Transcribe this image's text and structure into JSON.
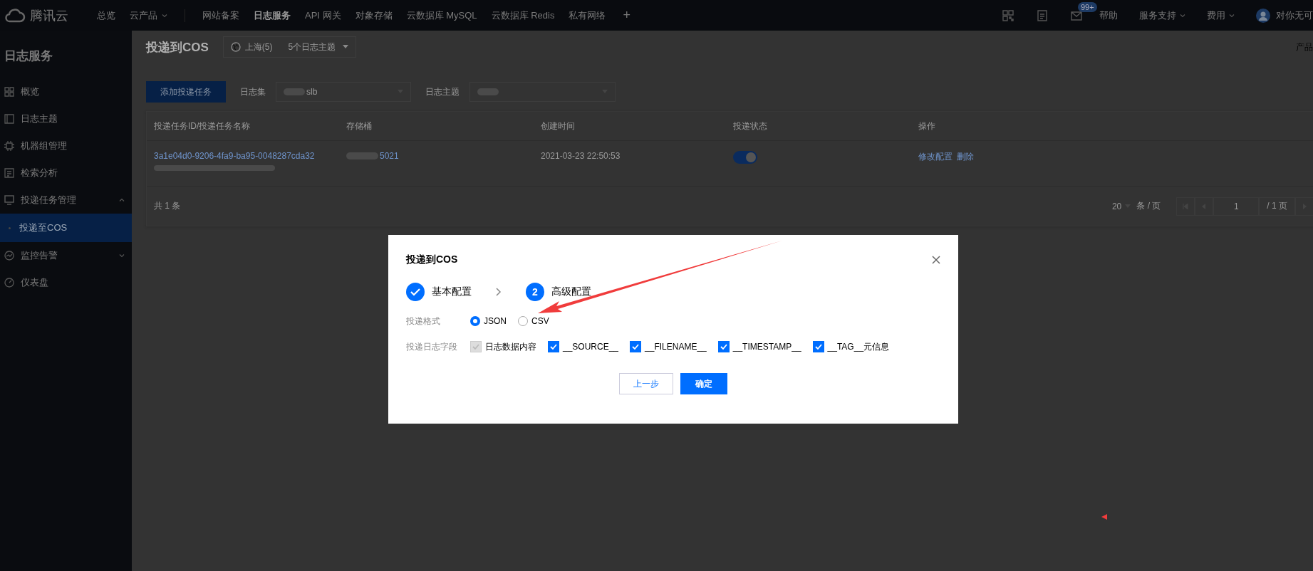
{
  "topbar": {
    "logo": "腾讯云",
    "nav": [
      {
        "label": "总览",
        "selected": false,
        "dropdown": false
      },
      {
        "label": "云产品",
        "selected": false,
        "dropdown": true
      },
      {
        "label": "网站备案",
        "selected": false,
        "dropdown": false
      },
      {
        "label": "日志服务",
        "selected": true,
        "dropdown": false
      },
      {
        "label": "API 网关",
        "selected": false,
        "dropdown": false
      },
      {
        "label": "对象存储",
        "selected": false,
        "dropdown": false
      },
      {
        "label": "云数据库 MySQL",
        "selected": false,
        "dropdown": false
      },
      {
        "label": "云数据库 Redis",
        "selected": false,
        "dropdown": false
      },
      {
        "label": "私有网络",
        "selected": false,
        "dropdown": false
      }
    ],
    "add": "+",
    "badge": "99+",
    "links": [
      {
        "label": "帮助",
        "dropdown": false
      },
      {
        "label": "服务支持",
        "dropdown": true
      },
      {
        "label": "费用",
        "dropdown": true
      }
    ],
    "user": "对你无可"
  },
  "sidebar": {
    "title": "日志服务",
    "items": [
      {
        "label": "概览",
        "kind": "grid",
        "selected": false
      },
      {
        "label": "日志主题",
        "kind": "book",
        "selected": false
      },
      {
        "label": "机器组管理",
        "kind": "chip",
        "selected": false
      },
      {
        "label": "检索分析",
        "kind": "doc",
        "selected": false
      },
      {
        "label": "投递任务管理",
        "kind": "tray",
        "selected": false,
        "expanded": true,
        "children": [
          {
            "label": "投递至COS",
            "selected": true
          }
        ]
      },
      {
        "label": "监控告警",
        "kind": "gauge",
        "selected": false,
        "expanded": false
      },
      {
        "label": "仪表盘",
        "kind": "dial",
        "selected": false
      }
    ]
  },
  "header": {
    "title": "投递到COS",
    "region": "上海(5)",
    "topics": "5个日志主题",
    "right": "产品"
  },
  "toolbar": {
    "add_button": "添加投递任务",
    "logset_label": "日志集",
    "logset_value": "slb",
    "topic_label": "日志主题"
  },
  "table": {
    "columns": [
      "投递任务ID/投递任务名称",
      "存储桶",
      "创建时间",
      "投递状态",
      "操作"
    ],
    "rows": [
      {
        "id": "3a1e04d0-9206-4fa9-ba95-0048287cda32",
        "bucket": "5021",
        "created": "2021-03-23 22:50:53",
        "on": true,
        "actions": [
          "修改配置",
          "删除"
        ]
      }
    ],
    "total": "共 1 条",
    "page_size": "20",
    "per_page": "条 / 页",
    "page": "1",
    "pages": "/ 1 页"
  },
  "dialog": {
    "title": "投递到COS",
    "steps": [
      {
        "label": "基本配置",
        "done": true
      },
      {
        "label": "高级配置",
        "number": "2",
        "done": false
      }
    ],
    "format_label": "投递格式",
    "formats": [
      {
        "label": "JSON",
        "selected": true
      },
      {
        "label": "CSV",
        "selected": false
      }
    ],
    "fields_label": "投递日志字段",
    "fields": [
      {
        "label": "日志数据内容",
        "checked": true,
        "disabled": true
      },
      {
        "label": "__SOURCE__",
        "checked": true,
        "disabled": false
      },
      {
        "label": "__FILENAME__",
        "checked": true,
        "disabled": false
      },
      {
        "label": "__TIMESTAMP__",
        "checked": true,
        "disabled": false
      },
      {
        "label": "__TAG__元信息",
        "checked": true,
        "disabled": false
      }
    ],
    "back": "上一步",
    "confirm": "确定"
  }
}
